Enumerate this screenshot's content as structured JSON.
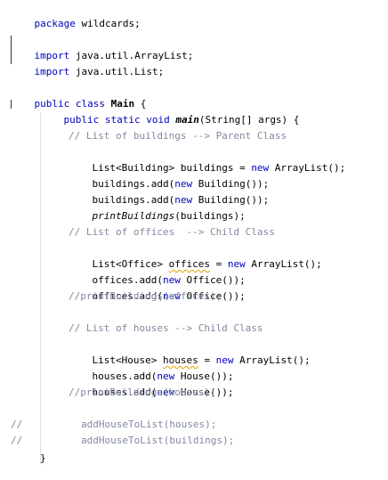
{
  "code": {
    "package_kw": "package",
    "package_name": " wildcards;",
    "import_kw": "import",
    "import_1": " java.util.ArrayList;",
    "import_2": " java.util.List;",
    "class_decl": {
      "kw": "public class",
      "name": " Main",
      "brace": " {"
    },
    "main_decl": {
      "kw": "public static void",
      "name": "main",
      "params": "(String[] args)",
      "brace": " {"
    },
    "block1": {
      "comment": "// List of buildings --> Parent Class",
      "decl_pre": "List<Building> buildings = ",
      "new_kw": "new",
      "decl_post": " ArrayList();",
      "add1_pre": "buildings.add(",
      "add1_post": " Building());",
      "add2_pre": "buildings.add(",
      "add2_post": " Building());",
      "print_name": "printBuildings",
      "print_args": "(buildings);"
    },
    "block2": {
      "comment": "// List of offices  --> Child Class",
      "decl_type": "List<Office> ",
      "decl_var": "offices",
      "decl_eq": " = ",
      "new_kw": "new",
      "decl_post": " ArrayList();",
      "add1_pre": "offices.add(",
      "add1_post": " Office());",
      "add2_pre": "offices.add(",
      "add2_post": " Office());",
      "commented_print": "//printBuildings(offices);"
    },
    "block3": {
      "comment": "// List of houses --> Child Class",
      "decl_type": "List<House> ",
      "decl_var": "houses",
      "decl_eq": " = ",
      "new_kw": "new",
      "decl_post": " ArrayList();",
      "add1_pre": "houses.add(",
      "add1_post": " House());",
      "add2_pre": "houses.add(",
      "add2_post": " House());",
      "commented_print": "//printBuildings(houses);"
    },
    "tail": {
      "comment_prefix": "//",
      "line1": "addHouseToList(houses);",
      "line2": "addHouseToList(buildings);",
      "closing_brace": "}"
    }
  },
  "colors": {
    "keyword": "#0000c0",
    "comment": "#7f8a9f",
    "default": "#000000",
    "warning_underline": "#e2a000"
  }
}
